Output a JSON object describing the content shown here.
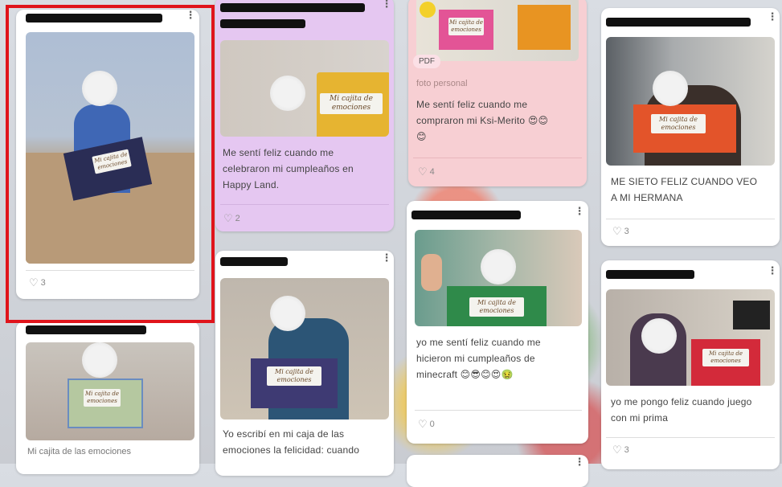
{
  "highlight_color": "#e0141b",
  "icons": {
    "more": "kebab-menu-icon",
    "like": "heart-icon",
    "emoji": "smiley-emoji-icon"
  },
  "posts": [
    {
      "likes": "3"
    },
    {
      "caption": "Mi cajita de las emociones"
    },
    {
      "caption_lines": [
        "Me sentí feliz cuando me",
        "celebraron mi cumpleaños en",
        "Happy Land."
      ],
      "likes": "2"
    },
    {
      "caption_lines": [
        "Yo escribí en mi caja de las",
        "emociones la felicidad: cuando"
      ]
    },
    {
      "badge": "PDF",
      "subtitle": "foto personal",
      "caption_lines": [
        "Me sentí feliz cuando me",
        "compraron mi Ksi-Merito 😍😊",
        "😊"
      ],
      "likes": "4"
    },
    {
      "caption_lines": [
        "yo me sentí feliz cuando me",
        "hicieron mi cumpleaños de",
        "minecraft 😊😎😊😍🤢"
      ],
      "likes": "0"
    },
    {
      "caption_lines": [
        "ME SIETO FELIZ CUANDO VEO",
        "A MI HERMANA"
      ],
      "likes": "3"
    },
    {
      "caption_lines": [
        "yo me pongo feliz cuando juego",
        "con mi prima"
      ],
      "likes": "3"
    }
  ],
  "box_label": [
    "Mi cajita de",
    "emociones"
  ]
}
